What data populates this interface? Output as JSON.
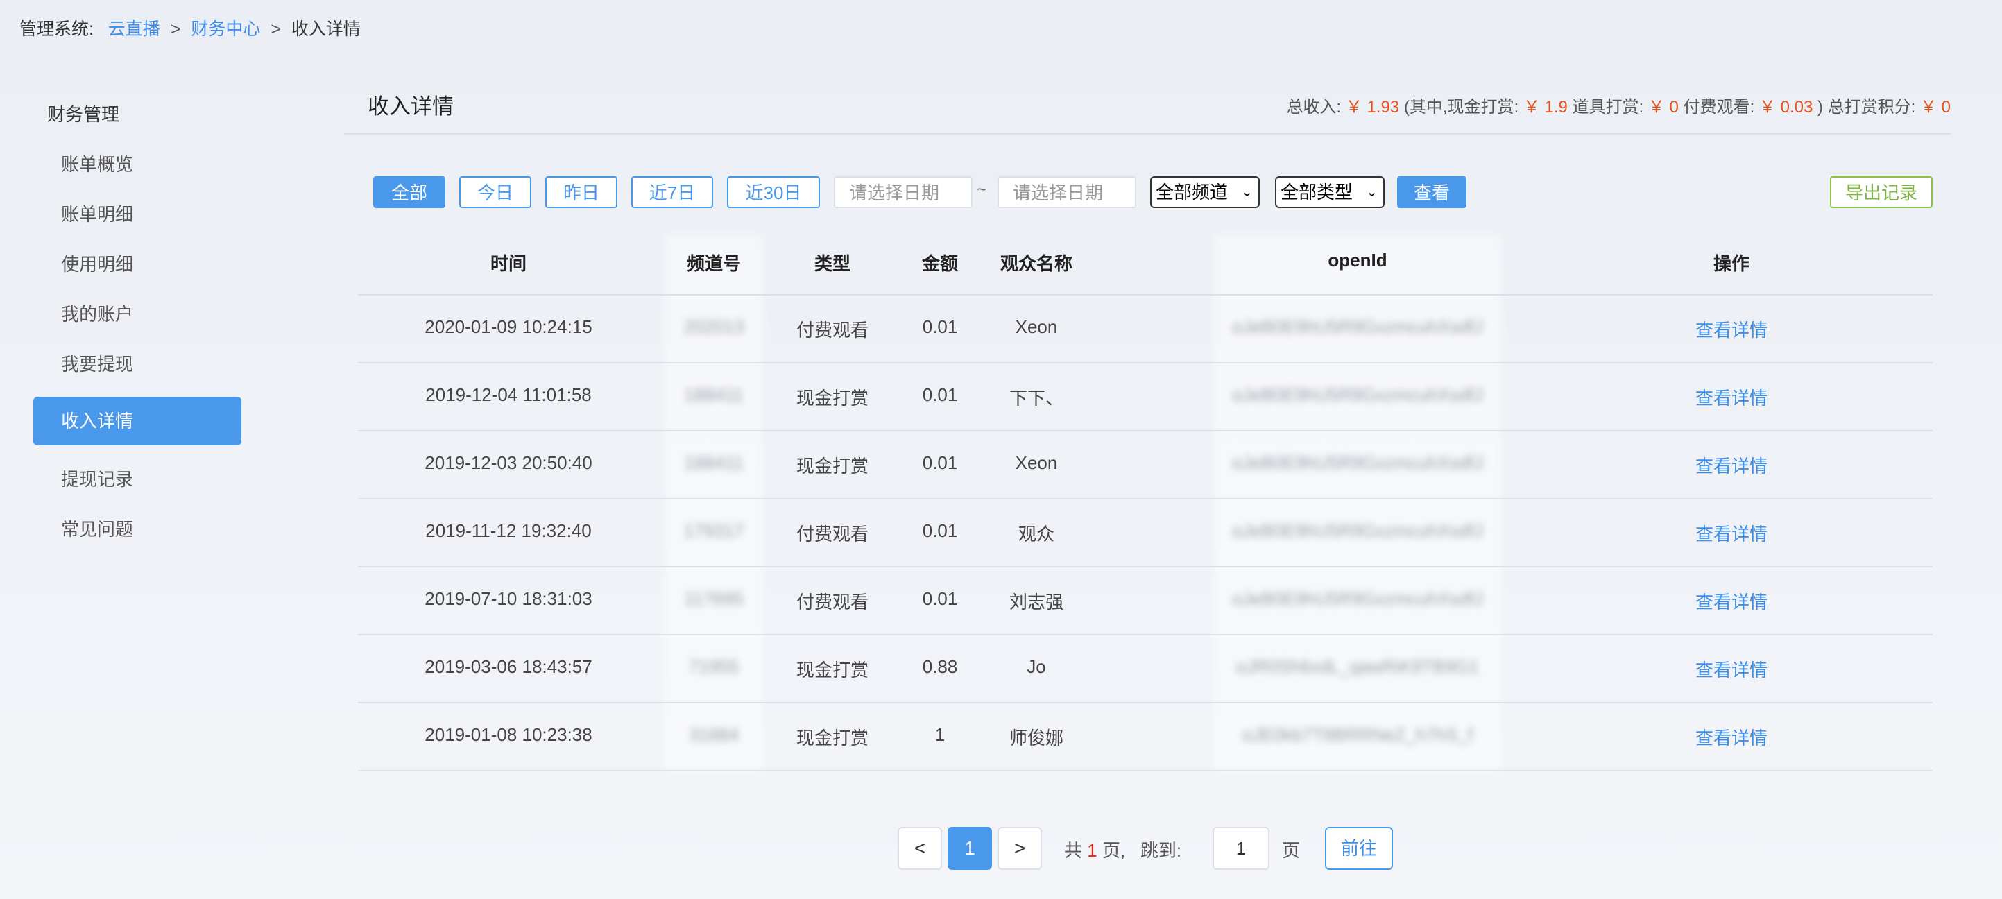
{
  "breadcrumb": {
    "prefix": "管理系统:",
    "items": [
      "云直播",
      "财务中心",
      "收入详情"
    ],
    "separator": ">"
  },
  "sidebar": {
    "group": "财务管理",
    "items": [
      "账单概览",
      "账单明细",
      "使用明细",
      "我的账户",
      "我要提现",
      "收入详情",
      "提现记录",
      "常见问题"
    ],
    "active": "收入详情"
  },
  "header": {
    "title": "收入详情",
    "summary": {
      "total_label": "总收入:",
      "total_value": "￥ 1.93",
      "cash_label": "(其中,现金打赏:",
      "cash_value": "￥ 1.9",
      "prop_label": "道具打赏:",
      "prop_value": "￥ 0",
      "paid_label": "付费观看:",
      "paid_value": "￥ 0.03",
      "points_label": ") 总打赏积分:",
      "points_value": "￥ 0"
    }
  },
  "filters": {
    "range_buttons": [
      "全部",
      "今日",
      "昨日",
      "近7日",
      "近30日"
    ],
    "active_range": "全部",
    "start_placeholder": "请选择日期",
    "tilde": "~",
    "end_placeholder": "请选择日期",
    "channel_select": "全部频道",
    "type_select": "全部类型",
    "query_button": "查看",
    "export_button": "导出记录"
  },
  "table": {
    "columns": [
      "时间",
      "频道号",
      "类型",
      "金额",
      "观众名称",
      "openId",
      "操作"
    ],
    "rows": [
      {
        "time": "2020-01-09 10:24:15",
        "channel": "202013",
        "type": "付费观看",
        "amount": "0.01",
        "viewer": "Xeon",
        "openid": "oJeB0E9hU5R9GxzmcuhXsdfJ",
        "action": "查看详情"
      },
      {
        "time": "2019-12-04 11:01:58",
        "channel": "188411",
        "type": "现金打赏",
        "amount": "0.01",
        "viewer": "下下、",
        "openid": "oJeB0E9hU5R9GxzmcuhXsdfJ",
        "action": "查看详情"
      },
      {
        "time": "2019-12-03 20:50:40",
        "channel": "188411",
        "type": "现金打赏",
        "amount": "0.01",
        "viewer": "Xeon",
        "openid": "oJeB0E9hU5R9GxzmcuhXsdfJ",
        "action": "查看详情"
      },
      {
        "time": "2019-11-12 19:32:40",
        "channel": "179317",
        "type": "付费观看",
        "amount": "0.01",
        "viewer": "观众",
        "openid": "oJeB0E9hU5R9GxzmcuhXsdfJ",
        "action": "查看详情"
      },
      {
        "time": "2019-07-10 18:31:03",
        "channel": "117695",
        "type": "付费观看",
        "amount": "0.01",
        "viewer": "刘志强",
        "openid": "oJeB0E9hU5R9GxzmcuhXsdfJ",
        "action": "查看详情"
      },
      {
        "time": "2019-03-06 18:43:57",
        "channel": "71955",
        "type": "现金打赏",
        "amount": "0.88",
        "viewer": "Jo",
        "openid": "oJR0Sh6xdL_qawRiK9TB9G1",
        "action": "查看详情"
      },
      {
        "time": "2019-01-08 10:23:38",
        "channel": "31884",
        "type": "现金打赏",
        "amount": "1",
        "viewer": "师俊娜",
        "openid": "oJE0kb7T8BRRNeZ_h7hS_f",
        "action": "查看详情"
      }
    ]
  },
  "pager": {
    "prev": "<",
    "current": "1",
    "next": ">",
    "total_prefix": "共",
    "total_pages": "1",
    "total_suffix": "页,",
    "jump_label": "跳到:",
    "jump_value": "1",
    "page_unit": "页",
    "go_button": "前往"
  },
  "colors": {
    "accent": "#4a98eb",
    "money": "#e8531c",
    "export": "#7cb342"
  }
}
